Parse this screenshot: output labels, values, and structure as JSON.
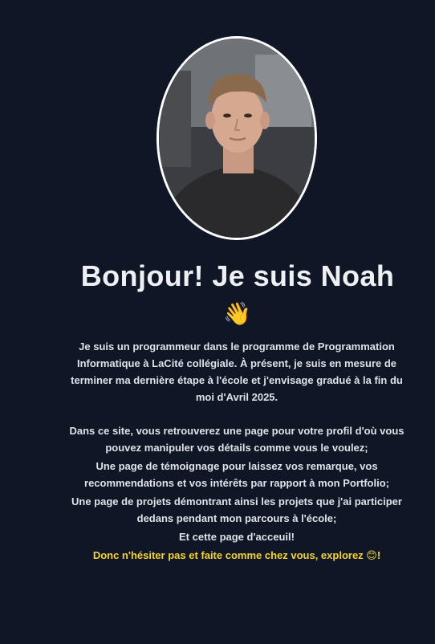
{
  "avatar": {
    "alt": "Noah"
  },
  "hero": {
    "title": "Bonjour! Je suis Noah",
    "wave_emoji": "👋"
  },
  "intro": {
    "p1": "Je suis un programmeur dans le programme de Programmation Informatique à LaCité collégiale. À présent, je suis en mesure de terminer ma dernière étape à l'école et j'envisage gradué à la fin du moi d'Avril 2025.",
    "p2": "Dans ce site, vous retrouverez une page pour votre profil d'où vous pouvez manipuler vos détails comme vous le voulez;",
    "p3": "Une page de témoignage pour laissez vos remarque, vos recommendations et vos intérêts par rapport à mon Portfolio;",
    "p4": "Une page de projets démontrant ainsi les projets que j'ai participer dedans pendant mon parcours à l'école;",
    "p5": "Et cette page d'acceuil!",
    "cta": "Donc n'hésiter pas et faite comme chez vous, explorez 😊!"
  },
  "colors": {
    "background": "#0f1626",
    "text": "#dfe2e7",
    "accent": "#f6d22d"
  }
}
